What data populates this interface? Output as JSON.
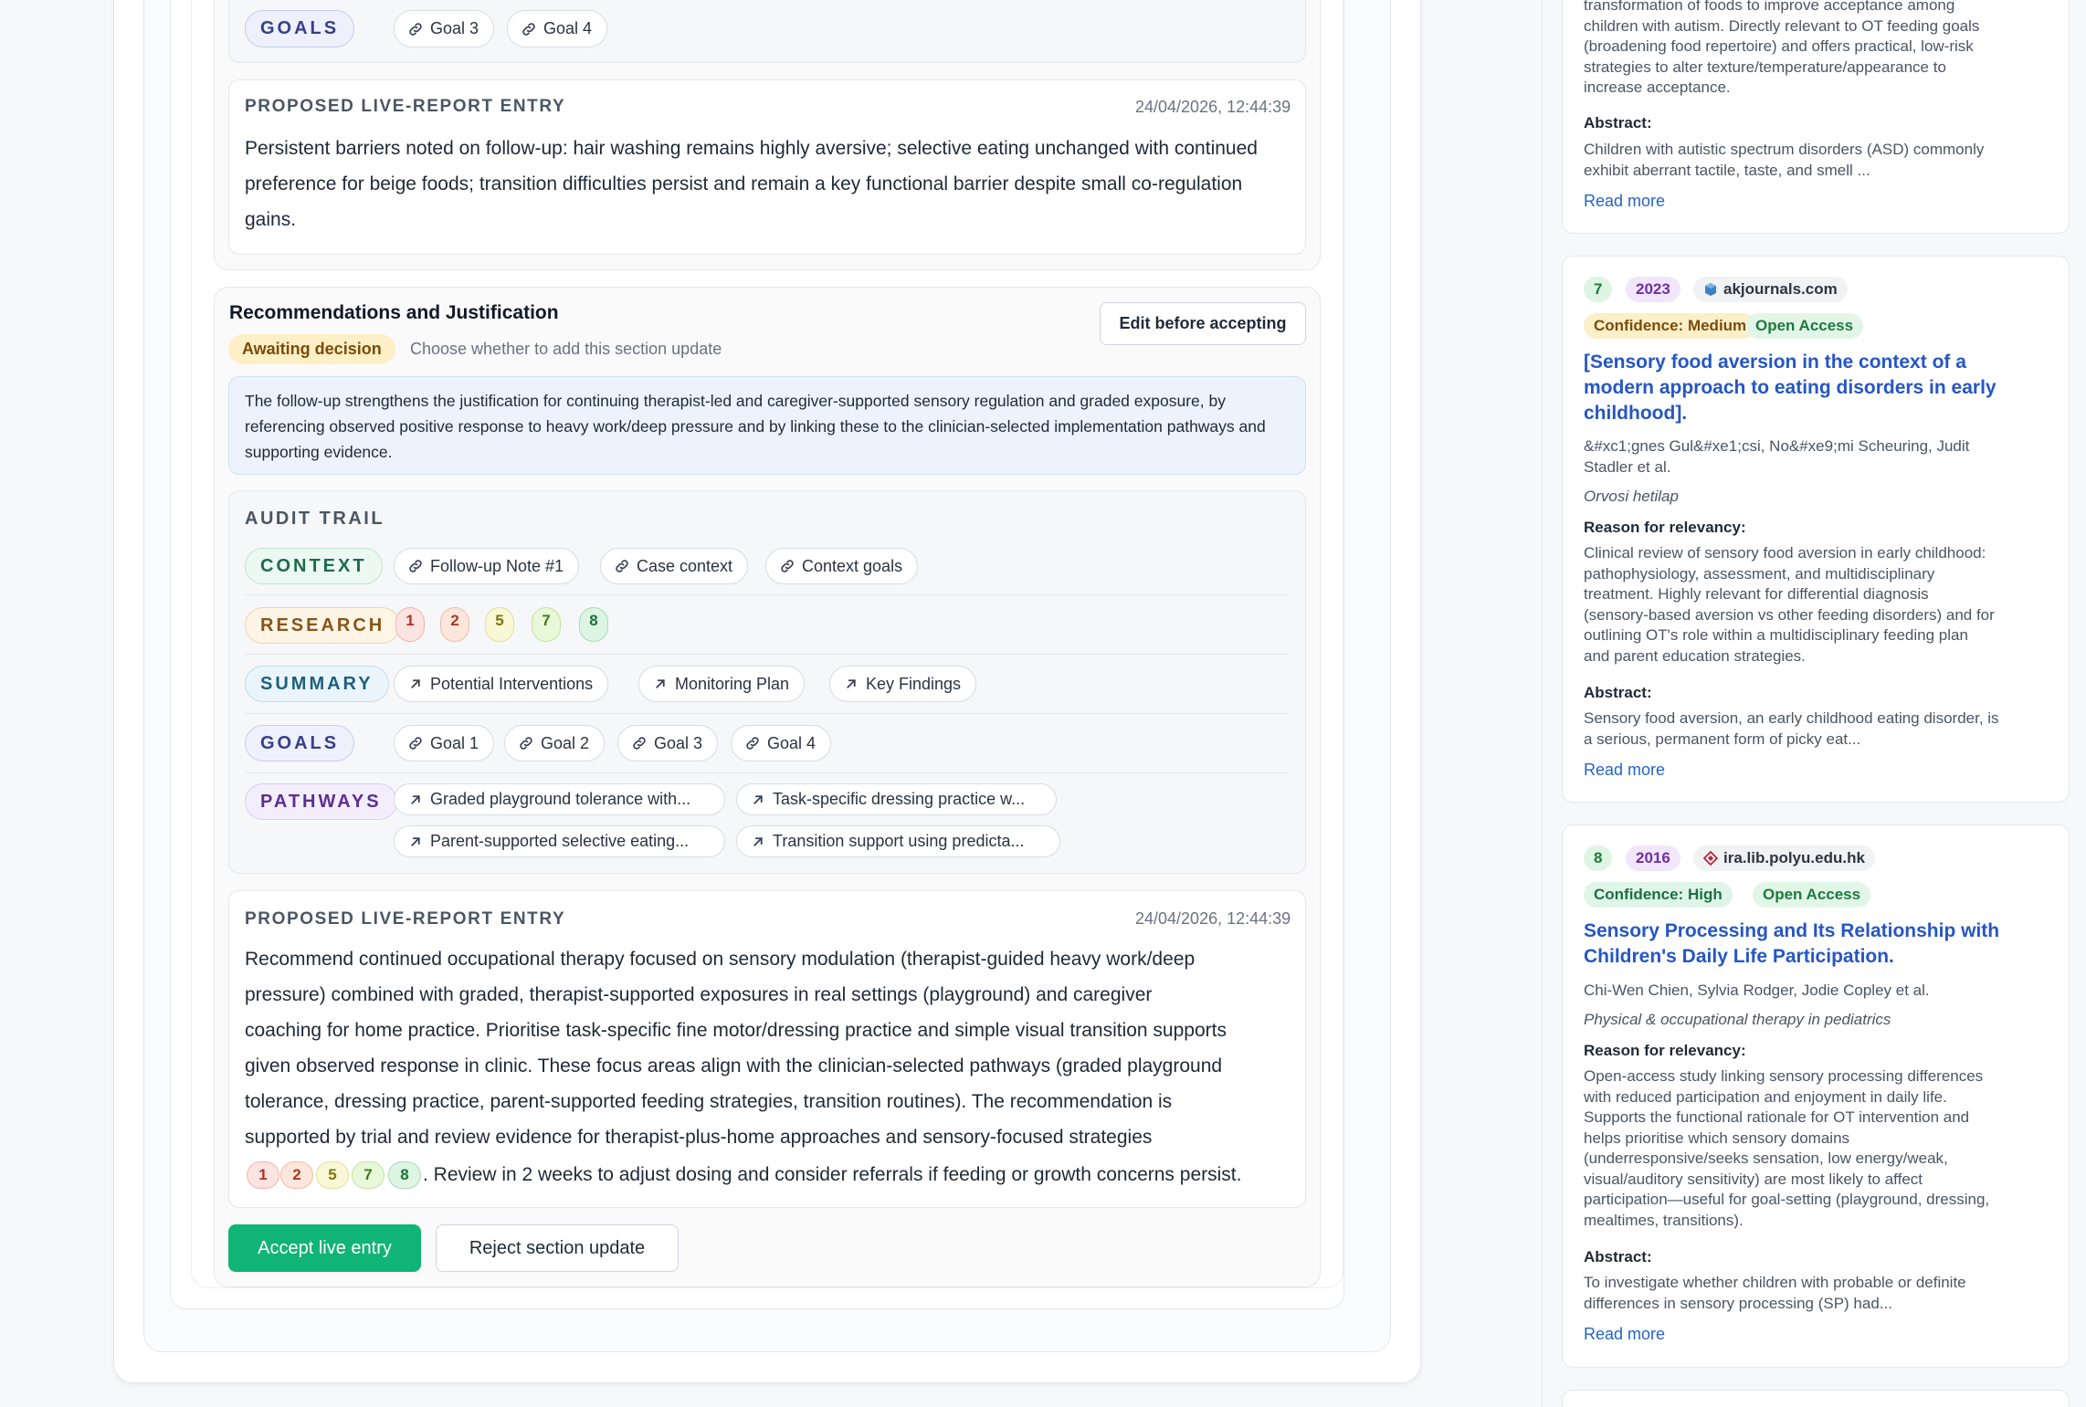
{
  "top_section": {
    "goals_tag": "GOALS",
    "goal_chips": [
      "Goal 3",
      "Goal 4"
    ],
    "entry_heading": "PROPOSED LIVE-REPORT ENTRY",
    "entry_timestamp": "24/04/2026, 12:44:39",
    "entry_text": "Persistent barriers noted on follow-up: hair washing remains highly aversive; selective eating unchanged with continued preference for beige foods; transition difficulties persist and remain a key functional barrier despite small co-regulation gains."
  },
  "rec_section": {
    "title": "Recommendations and Justification",
    "status_badge": "Awaiting decision",
    "status_hint": "Choose whether to add this section update",
    "edit_button": "Edit before accepting",
    "justification": "The follow-up strengthens the justification for continuing therapist-led and caregiver-supported sensory regulation and graded exposure, by referencing observed positive response to heavy work/deep pressure and by linking these to the clinician-selected implementation pathways and supporting evidence.",
    "audit": {
      "heading": "AUDIT TRAIL",
      "context_tag": "CONTEXT",
      "context_chips": [
        "Follow-up Note #1",
        "Case context",
        "Context goals"
      ],
      "research_tag": "RESEARCH",
      "research_refs": [
        "1",
        "2",
        "5",
        "7",
        "8"
      ],
      "summary_tag": "SUMMARY",
      "summary_chips": [
        "Potential Interventions",
        "Monitoring Plan",
        "Key Findings"
      ],
      "goals_tag": "GOALS",
      "goal_chips": [
        "Goal 1",
        "Goal 2",
        "Goal 3",
        "Goal 4"
      ],
      "pathways_tag": "PATHWAYS",
      "pathway_chips": [
        "Graded playground tolerance with...",
        "Task-specific dressing practice w...",
        "Parent-supported selective eating...",
        "Transition support using predicta..."
      ]
    },
    "entry_heading": "PROPOSED LIVE-REPORT ENTRY",
    "entry_timestamp": "24/04/2026, 12:44:39",
    "entry_lines": [
      "Recommend continued occupational therapy focused on sensory modulation (therapist-guided heavy work/deep",
      "pressure) combined with graded, therapist-supported exposures in real settings (playground) and caregiver",
      "coaching for home practice. Prioritise task-specific fine motor/dressing practice and simple visual transition supports",
      "given observed response in clinic. These focus areas align with the clinician-selected pathways (graded playground",
      "tolerance, dressing practice, parent-supported feeding strategies, transition routines). The recommendation is",
      "supported by trial and review evidence for therapist-plus-home approaches and sensory-focused strategies"
    ],
    "entry_citations": [
      "1",
      "2",
      "5",
      "7",
      "8"
    ],
    "entry_tail": ". Review in 2 weeks to adjust dosing and consider referrals if feeding or growth concerns persist.",
    "accept_button": "Accept live entry",
    "reject_button": "Reject section update"
  },
  "sidebar": {
    "card1": {
      "relevance_lines": [
        "transformation of foods to improve acceptance among",
        "children with autism. Directly relevant to OT feeding goals",
        "(broadening food repertoire) and offers practical, low-risk",
        "strategies to alter texture/temperature/appearance to",
        "increase acceptance."
      ],
      "abstract_label": "Abstract:",
      "abstract_lines": [
        "Children with autistic spectrum disorders (ASD) commonly",
        "exhibit aberrant tactile, taste, and smell ..."
      ],
      "read_more": "Read more"
    },
    "card2": {
      "number": "7",
      "year": "2023",
      "source": "akjournals.com",
      "confidence": "Confidence: Medium",
      "access": "Open Access",
      "title_lines": [
        "[Sensory food aversion in the context of a",
        "modern approach to eating disorders in early",
        "childhood]."
      ],
      "authors_lines": [
        "&#xc1;gnes Gul&#xe1;csi, No&#xe9;mi Scheuring, Judit",
        "Stadler et al."
      ],
      "journal": "Orvosi hetilap",
      "reason_label": "Reason for relevancy:",
      "reason_lines": [
        "Clinical review of sensory food aversion in early childhood:",
        "pathophysiology, assessment, and multidisciplinary",
        "treatment. Highly relevant for differential diagnosis",
        "(sensory-based aversion vs other feeding disorders) and for",
        "outlining OT's role within a multidisciplinary feeding plan",
        "and parent education strategies."
      ],
      "abstract_label": "Abstract:",
      "abstract_lines": [
        "Sensory food aversion, an early childhood eating disorder, is",
        "a serious, permanent form of picky eat..."
      ],
      "read_more": "Read more"
    },
    "card3": {
      "number": "8",
      "year": "2016",
      "source": "ira.lib.polyu.edu.hk",
      "confidence": "Confidence: High",
      "access": "Open Access",
      "title_lines": [
        "Sensory Processing and Its Relationship with",
        "Children's Daily Life Participation."
      ],
      "authors": "Chi-Wen Chien, Sylvia Rodger, Jodie Copley et al.",
      "journal": "Physical & occupational therapy in pediatrics",
      "reason_label": "Reason for relevancy:",
      "reason_lines": [
        "Open-access study linking sensory processing differences",
        "with reduced participation and enjoyment in daily life.",
        "Supports the functional rationale for OT intervention and",
        "helps prioritise which sensory domains",
        "(underresponsive/seeks sensation, low energy/weak,",
        "visual/auditory sensitivity) are most likely to affect",
        "participation—useful for goal-setting (playground, dressing,",
        "mealtimes, transitions)."
      ],
      "abstract_label": "Abstract:",
      "abstract_lines": [
        "To investigate whether children with probable or definite",
        "differences in sensory processing (SP) had..."
      ],
      "read_more": "Read more"
    }
  }
}
